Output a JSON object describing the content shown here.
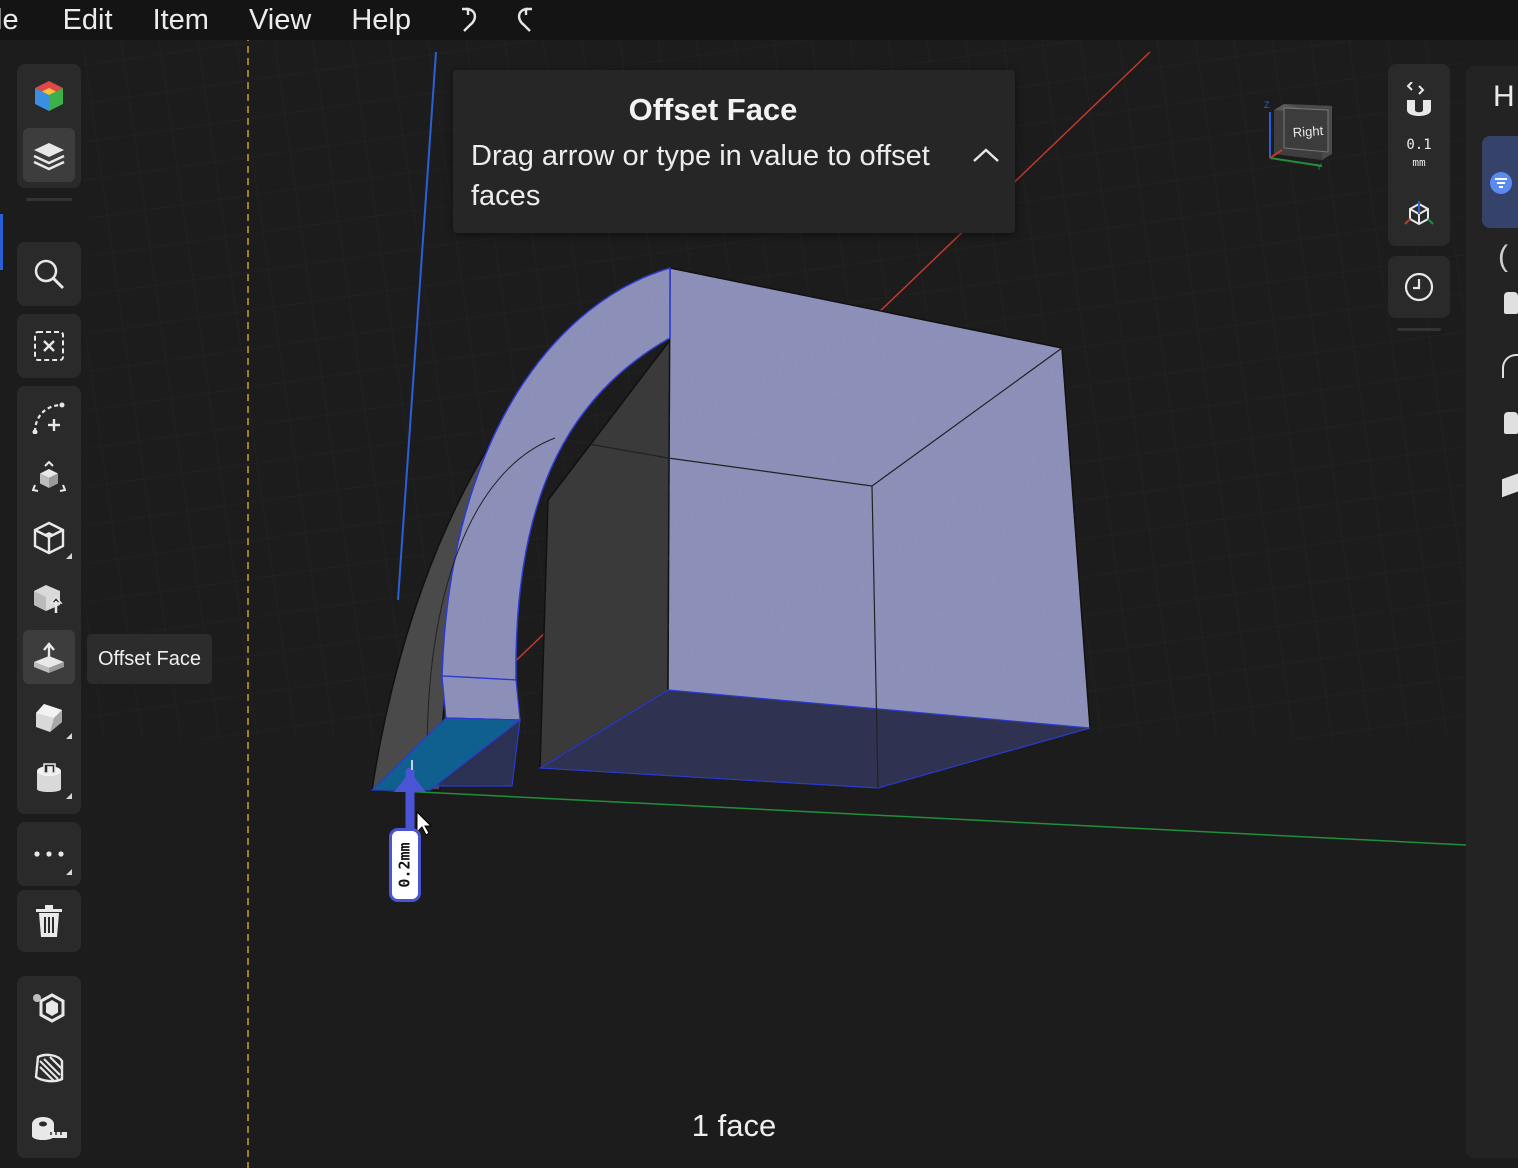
{
  "menu": {
    "file": "le",
    "edit": "Edit",
    "item": "Item",
    "view": "View",
    "help": "Help"
  },
  "tooltip": {
    "label": "Offset Face"
  },
  "hint": {
    "title": "Offset Face",
    "text": "Drag arrow or type in value to offset faces"
  },
  "view_cube": {
    "face_label": "Right",
    "axis_z": "Z",
    "axis_y": "Y"
  },
  "right_toolbar": {
    "snap_value": "0.1",
    "snap_unit": "mm"
  },
  "right_panel": {
    "title": "H",
    "paren": "("
  },
  "dimension": {
    "value": "0.2mm"
  },
  "status": {
    "selection_count": "1 face"
  },
  "colors": {
    "accent": "#4a55d6",
    "selected_face": "#0f5f8f",
    "model_face": "#8c90b8",
    "axis_red": "#c0392b",
    "axis_green": "#1f8f3a",
    "axis_blue": "#2b5fd6",
    "guide_yellow": "#c9a227"
  },
  "left_toolbar": {
    "icons": [
      "appearance-cube-icon",
      "layers-icon",
      "search-icon",
      "deselect-icon",
      "sketch-arc-icon",
      "transform-icon",
      "primitives-icon",
      "extrude-icon",
      "offset-face-icon",
      "chamfer-icon",
      "shell-icon",
      "more-icon",
      "trash-icon",
      "mesh-icon",
      "pattern-icon",
      "measure-icon"
    ]
  }
}
